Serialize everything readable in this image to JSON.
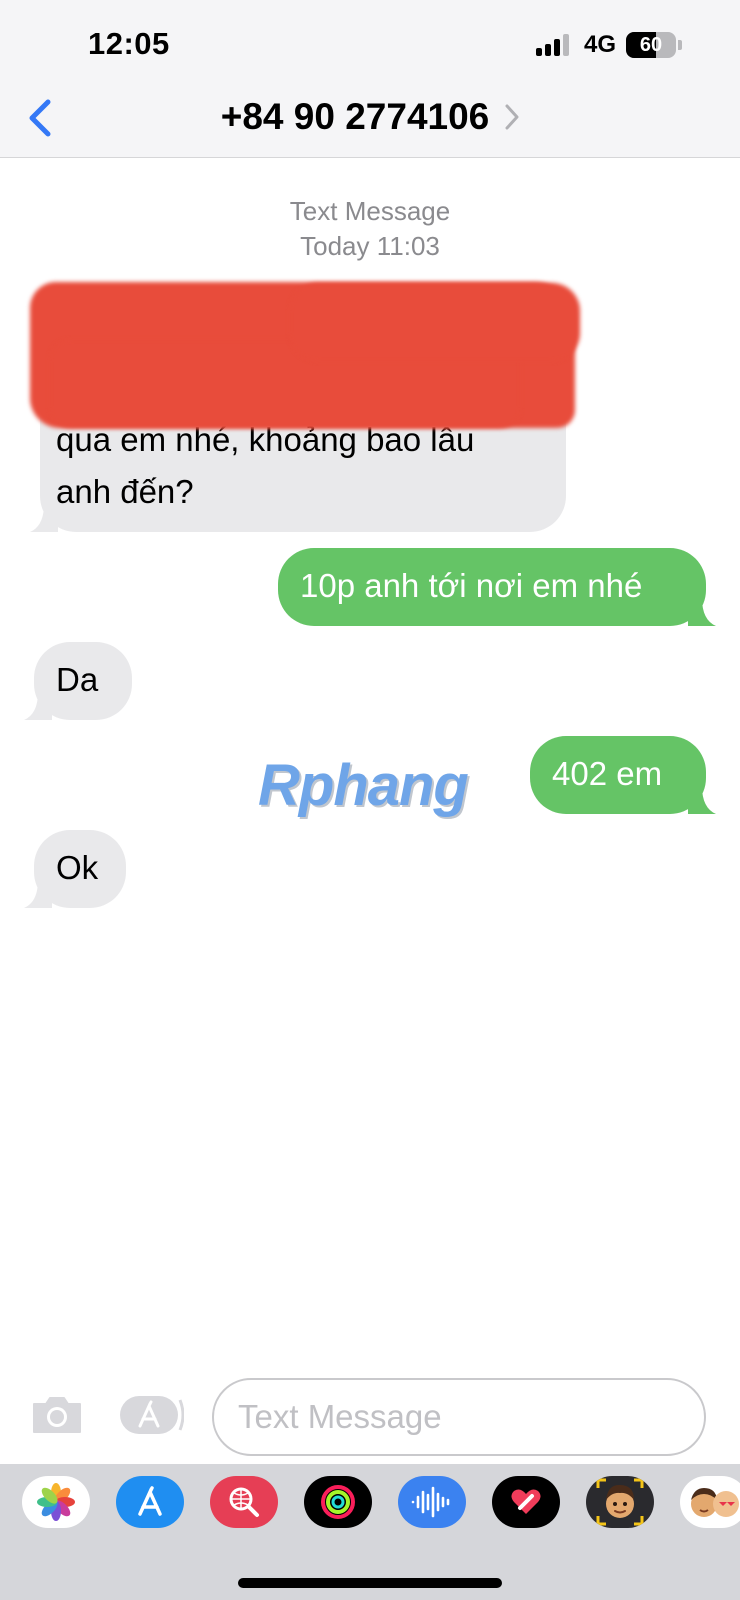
{
  "status_bar": {
    "time": "12:05",
    "network": "4G",
    "battery": "60",
    "battery_level": 0.6
  },
  "header": {
    "contact": "+84 90 2774106"
  },
  "thread": {
    "service": "Text Message",
    "timestamp": "Today 11:03",
    "messages": [
      {
        "direction": "incoming",
        "lines": [
          "qua em nhé, khoảng bao lâu",
          "anh đến?"
        ],
        "redacted_lines": 2
      },
      {
        "direction": "outgoing",
        "text": "10p anh tới nơi em nhé"
      },
      {
        "direction": "incoming",
        "text": "Da"
      },
      {
        "direction": "outgoing",
        "text": "402 em"
      },
      {
        "direction": "incoming",
        "text": "Ok"
      }
    ]
  },
  "watermark": "Rphang",
  "composer": {
    "placeholder": "Text Message"
  },
  "app_drawer": [
    "photos-icon",
    "app-store-icon",
    "web-images-icon",
    "activity-icon",
    "audio-message-icon",
    "digital-touch-icon",
    "memoji-icon",
    "memoji-stickers-icon"
  ],
  "colors": {
    "outgoing_bubble": "#65c466",
    "incoming_bubble": "#e9e9eb",
    "accent": "#3478f6"
  }
}
